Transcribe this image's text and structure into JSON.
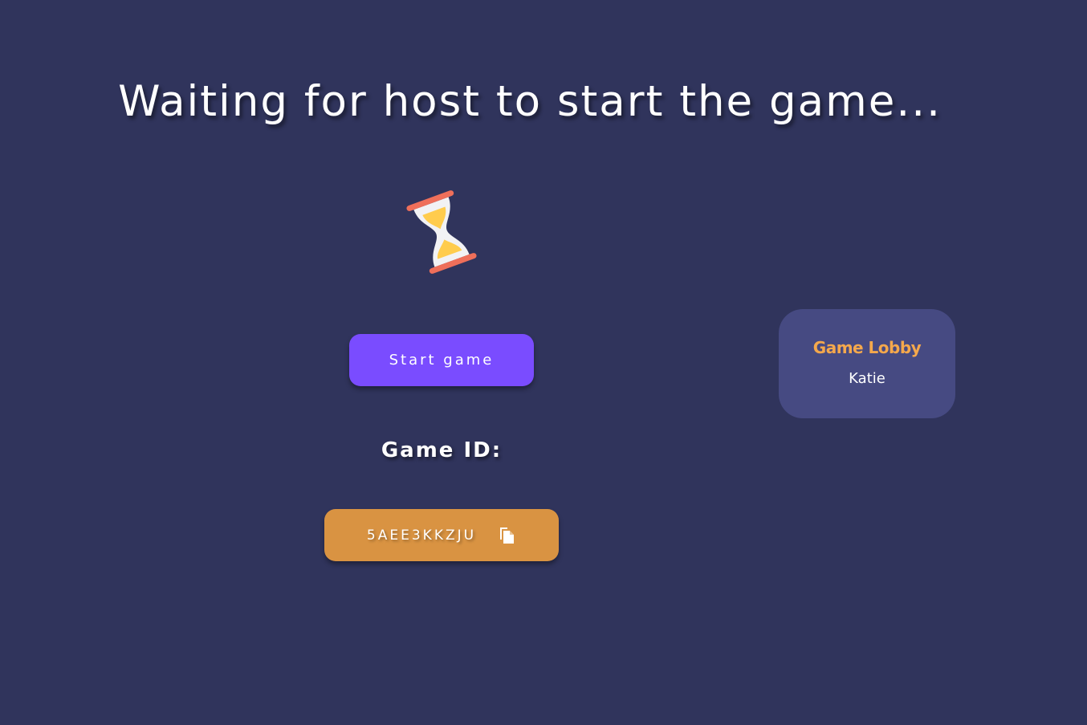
{
  "header": {
    "title": "Waiting for host to start the game..."
  },
  "status_icon": "hourglass-icon",
  "controls": {
    "start_label": "Start game"
  },
  "game_id": {
    "label": "Game ID:",
    "value": "5AEE3KKZJU",
    "copy_icon": "copy-icon"
  },
  "lobby": {
    "title": "Game Lobby",
    "players": [
      "Katie"
    ]
  },
  "colors": {
    "background": "#30345c",
    "start_button": "#7a4cff",
    "game_id_button": "#d99342",
    "lobby_panel": "#464a82",
    "lobby_title": "#f4a84c",
    "hourglass_frame": "#ef6f5a",
    "hourglass_sand": "#ffcc4d"
  }
}
